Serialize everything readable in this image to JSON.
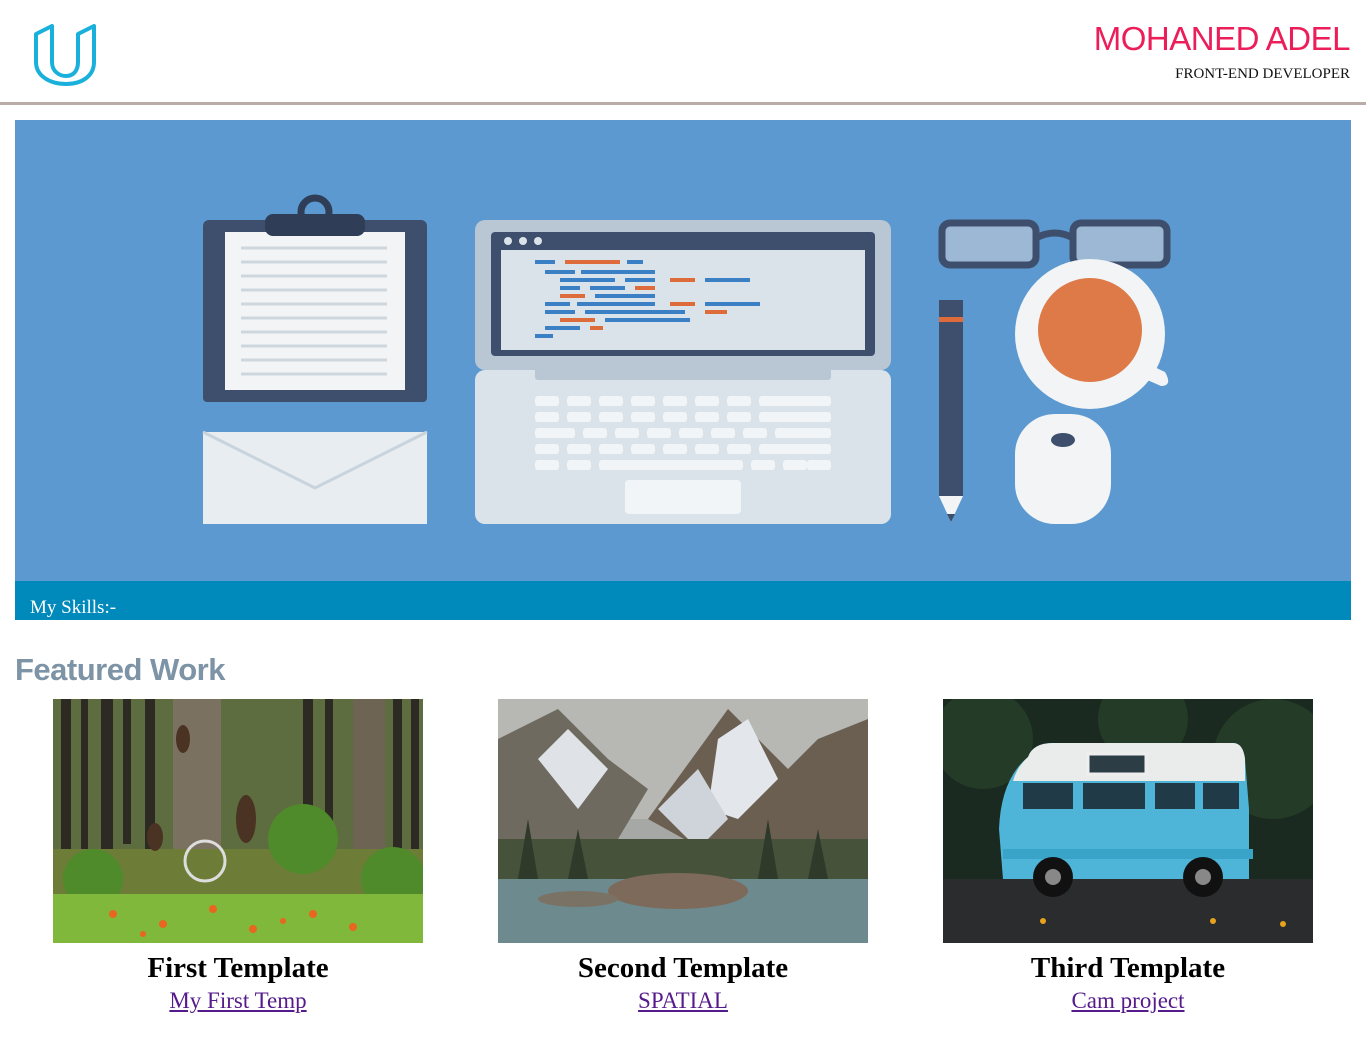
{
  "header": {
    "name": "MOHANED ADEL",
    "role": "FRONT-END DEVELOPER",
    "logo_icon": "udacity-logo-icon",
    "brand_color": "#ec1e5a"
  },
  "hero": {
    "skills_label": "My Skills:-",
    "bar_color": "#0089bb",
    "background_color": "#5b99d0"
  },
  "featured": {
    "title": "Featured Work",
    "cards": [
      {
        "title": "First Template",
        "link": "My First Temp",
        "image": "forest-bears-image"
      },
      {
        "title": "Second Template",
        "link": "SPATIAL",
        "image": "mountain-lake-image"
      },
      {
        "title": "Third Template",
        "link": "Cam project",
        "image": "blue-van-image"
      }
    ]
  }
}
